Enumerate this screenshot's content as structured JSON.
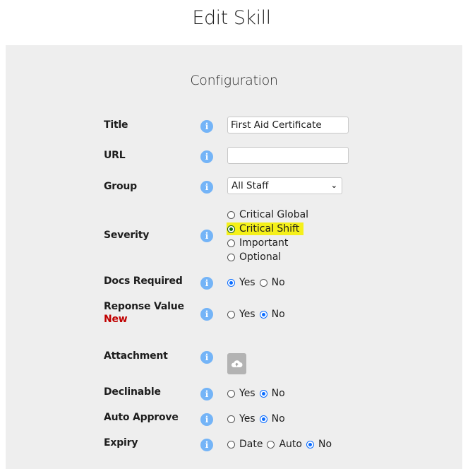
{
  "page": {
    "title": "Edit Skill"
  },
  "section": {
    "title": "Configuration"
  },
  "fields": {
    "title": {
      "label": "Title",
      "value": "First Aid Certificate"
    },
    "url": {
      "label": "URL",
      "value": ""
    },
    "group": {
      "label": "Group",
      "selected": "All Staff"
    },
    "severity": {
      "label": "Severity",
      "options": [
        "Critical Global",
        "Critical Shift",
        "Important",
        "Optional"
      ],
      "selected": "Critical Shift"
    },
    "docs_required": {
      "label": "Docs Required",
      "options": [
        "Yes",
        "No"
      ],
      "selected": "Yes"
    },
    "response_value": {
      "label": "Reponse Value",
      "badge": "New",
      "options": [
        "Yes",
        "No"
      ],
      "selected": "No"
    },
    "attachment": {
      "label": "Attachment",
      "icon": "cloud-upload-icon"
    },
    "declinable": {
      "label": "Declinable",
      "options": [
        "Yes",
        "No"
      ],
      "selected": "No"
    },
    "auto_approve": {
      "label": "Auto Approve",
      "options": [
        "Yes",
        "No"
      ],
      "selected": "No"
    },
    "expiry": {
      "label": "Expiry",
      "options": [
        "Date",
        "Auto",
        "No"
      ],
      "selected": "No"
    }
  },
  "icons": {
    "info": "i",
    "chevron": "❯"
  },
  "colors": {
    "info_icon": "#74b4f7",
    "highlight": "#f5f01a",
    "new_badge": "#c00000",
    "radio_checked": "#0a6cff"
  }
}
